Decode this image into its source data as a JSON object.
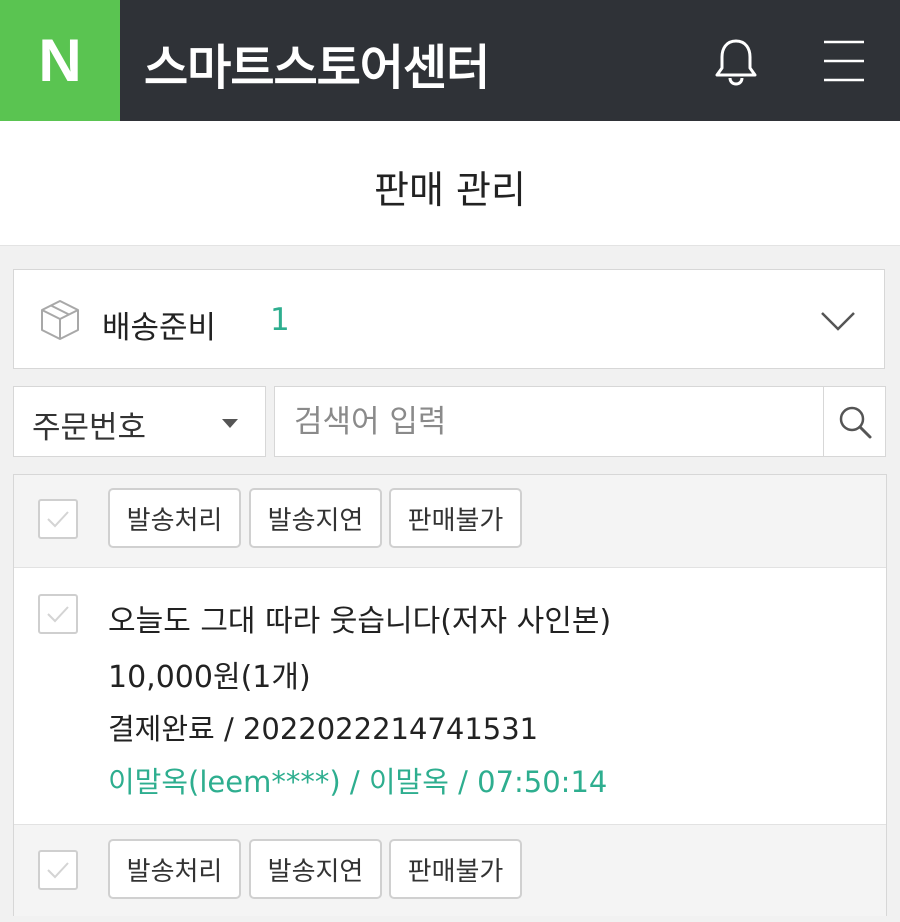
{
  "app": {
    "logo_letter": "N",
    "title": "스마트스토어센터",
    "brand_color": "#5ac451",
    "topbar_color": "#2f3237"
  },
  "header": {
    "page_title": "판매 관리"
  },
  "status_filter": {
    "label": "배송준비",
    "count": "1",
    "icon": "box-icon",
    "dropdown_icon": "chevron-down-icon"
  },
  "search": {
    "type_selected": "주문번호",
    "placeholder": "검색어 입력",
    "value": ""
  },
  "actions": {
    "ship": "발송처리",
    "delay": "발송지연",
    "unavailable": "판매불가"
  },
  "order": {
    "title": "오늘도 그대 따라 웃습니다(저자 사인본)",
    "price_qty": "10,000원(1개)",
    "payment": "결제완료 / 2022022214741531",
    "buyer": "이말옥(leem****) / 이말옥 / 07:50:14",
    "accent_color": "#2eae8f"
  }
}
